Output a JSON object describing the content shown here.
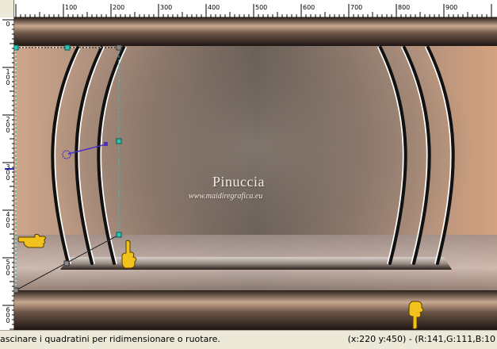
{
  "ruler": {
    "top_labels": [
      "100",
      "200",
      "300",
      "400",
      "500",
      "600",
      "700",
      "800",
      "900"
    ],
    "left_labels": [
      "0",
      "100",
      "200",
      "300",
      "400",
      "500",
      "600"
    ]
  },
  "canvas": {
    "watermark_title": "Pinuccia",
    "watermark_url": "www.maidiregrafica.eu"
  },
  "statusbar": {
    "hint": "ascinare i quadratini per ridimensionare o ruotare.",
    "coords": "(x:220 y:450) - (R:141,G:111,B:10"
  },
  "colors": {
    "ruler_bg": "#ffffff",
    "chrome_bg": "#ece9d8",
    "handle": "#2fc4b4"
  }
}
